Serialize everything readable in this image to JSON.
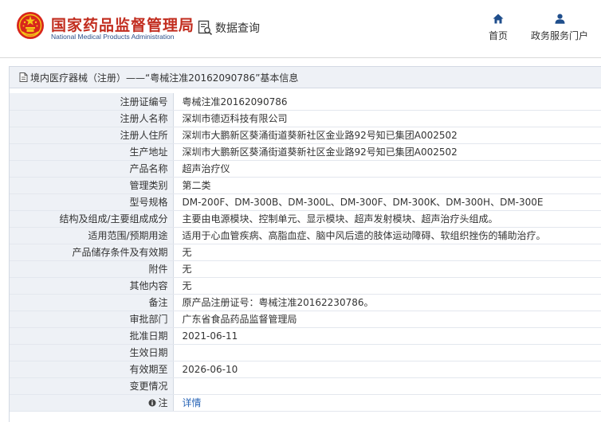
{
  "header": {
    "title": "国家药品监督管理局",
    "subtitle": "National Medical Products Administration",
    "data_query": "数据查询",
    "nav": [
      {
        "label": "首页",
        "icon": "home-icon"
      },
      {
        "label": "政务服务门户",
        "icon": "user-icon"
      }
    ]
  },
  "breadcrumb": {
    "text": "境内医疗器械（注册）——“粤械注准20162090786”基本信息",
    "icon": "document-icon"
  },
  "rows": [
    {
      "key": "注册证编号",
      "value": "粤械注准20162090786"
    },
    {
      "key": "注册人名称",
      "value": "深圳市德迈科技有限公司"
    },
    {
      "key": "注册人住所",
      "value": "深圳市大鹏新区葵涌街道葵新社区金业路92号知已集团A002502"
    },
    {
      "key": "生产地址",
      "value": "深圳市大鹏新区葵涌街道葵新社区金业路92号知已集团A002502"
    },
    {
      "key": "产品名称",
      "value": "超声治疗仪"
    },
    {
      "key": "管理类别",
      "value": "第二类"
    },
    {
      "key": "型号规格",
      "value": "DM-200F、DM-300B、DM-300L、DM-300F、DM-300K、DM-300H、DM-300E"
    },
    {
      "key": "结构及组成/主要组成成分",
      "value": "主要由电源模块、控制单元、显示模块、超声发射模块、超声治疗头组成。"
    },
    {
      "key": "适用范围/预期用途",
      "value": "适用于心血管疾病、高脂血症、脑中风后遗的肢体运动障碍、软组织挫伤的辅助治疗。"
    },
    {
      "key": "产品储存条件及有效期",
      "value": "无"
    },
    {
      "key": "附件",
      "value": "无"
    },
    {
      "key": "其他内容",
      "value": "无"
    },
    {
      "key": "备注",
      "value": "原产品注册证号：粤械注准20162230786。"
    },
    {
      "key": "审批部门",
      "value": "广东省食品药品监督管理局"
    },
    {
      "key": "批准日期",
      "value": "2021-06-11"
    },
    {
      "key": "生效日期",
      "value": ""
    },
    {
      "key": "有效期至",
      "value": "2026-06-10"
    },
    {
      "key": "变更情况",
      "value": ""
    },
    {
      "key": "注",
      "value": "详情",
      "icon": "info-icon"
    }
  ],
  "colors": {
    "brand_red": "#c22d1f",
    "subtitle_blue": "#2b4f8a",
    "link_blue": "#2a66b7",
    "nav_icon_blue": "#1f4e8c",
    "label_bg": "#eef1f6"
  }
}
